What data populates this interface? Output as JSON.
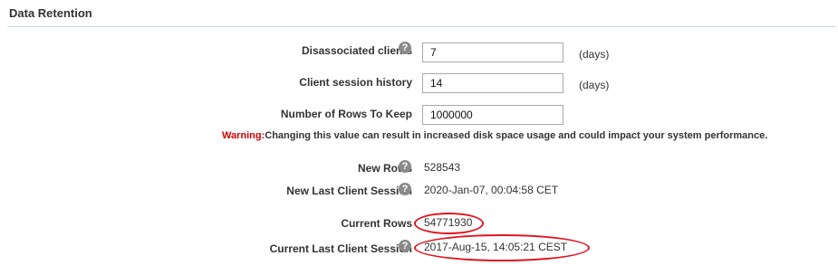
{
  "section": {
    "title": "Data Retention"
  },
  "rows": [
    {
      "label": "Disassociated clients",
      "input_value": "7",
      "unit": "(days)"
    },
    {
      "label": "Client session history",
      "input_value": "14",
      "unit": "(days)"
    },
    {
      "label": "Number of Rows To Keep",
      "input_value": "1000000"
    }
  ],
  "warning": {
    "label": "Warning:",
    "text": "Changing this value can result in increased disk space usage and could impact your system performance."
  },
  "stats": {
    "new_rows": {
      "label": "New Rows",
      "value": "528543"
    },
    "new_last_session": {
      "label": "New Last Client Session",
      "value": "2020-Jan-07, 00:04:58 CET"
    },
    "current_rows": {
      "label": "Current Rows",
      "value": "54771930"
    },
    "current_last_session": {
      "label": "Current Last Client Session",
      "value": "2017-Aug-15, 14:05:21 CEST"
    }
  },
  "icons": {
    "help": "help-icon",
    "help_glyph": "?"
  },
  "colors": {
    "warning": "#d40000",
    "annotation_ellipse": "#e0141e",
    "section_line": "#c9dcea"
  }
}
